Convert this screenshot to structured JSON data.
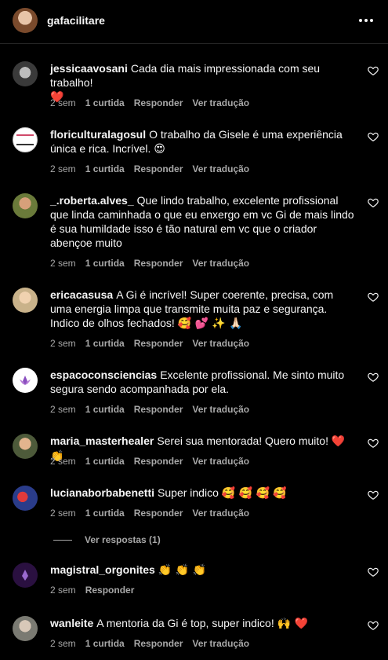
{
  "post": {
    "username": "gafacilitare"
  },
  "comments": [
    {
      "username": "jessicaavosani",
      "text": "Cada dia mais impressionada com seu trabalho!",
      "emoji": "❤️",
      "time": "2 sem",
      "likes": "1 curtida",
      "reply": "Responder",
      "translate": "Ver tradução"
    },
    {
      "username": "floriculturalagosul",
      "text": "O trabalho da Gisele é uma experiência única e rica. Incrível.",
      "emoji": "😍",
      "time": "2 sem",
      "likes": "1 curtida",
      "reply": "Responder",
      "translate": "Ver tradução"
    },
    {
      "username": "_.roberta.alves_",
      "text": "Que lindo trabalho, excelente profissional que linda caminhada o que eu enxergo em vc Gi de mais lindo é sua humildade isso é tão natural em vc que o criador abençoe muito",
      "emoji": "",
      "time": "2 sem",
      "likes": "1 curtida",
      "reply": "Responder",
      "translate": "Ver tradução"
    },
    {
      "username": "ericacasusa",
      "text": "A Gi é incrível! Super coerente, precisa, com uma energia limpa que transmite muita paz e segurança. Indico de olhos fechados!",
      "emoji": "🥰 💕 ✨ 🙏🏻",
      "time": "2 sem",
      "likes": "1 curtida",
      "reply": "Responder",
      "translate": "Ver tradução"
    },
    {
      "username": "espacoconsciencias",
      "text": "Excelente profissional. Me sinto muito segura sendo acompanhada por ela.",
      "emoji": "",
      "time": "2 sem",
      "likes": "1 curtida",
      "reply": "Responder",
      "translate": "Ver tradução"
    },
    {
      "username": "maria_masterhealer",
      "text": "Serei sua mentorada! Quero muito!",
      "emoji": "❤️ 👏",
      "time": "2 sem",
      "likes": "1 curtida",
      "reply": "Responder",
      "translate": "Ver tradução"
    },
    {
      "username": "lucianaborbabenetti",
      "text": "Super indico",
      "emoji": "🥰 🥰 🥰 🥰",
      "time": "2 sem",
      "likes": "1 curtida",
      "reply": "Responder",
      "translate": "Ver tradução",
      "view_replies": "Ver respostas (1)"
    },
    {
      "username": "magistral_orgonites",
      "text": "",
      "emoji": "👏 👏 👏",
      "time": "2 sem",
      "likes": "",
      "reply": "Responder",
      "translate": ""
    },
    {
      "username": "wanleite",
      "text": "A mentoria da Gi é top, super indico!",
      "emoji": "🙌 ❤️",
      "time": "2 sem",
      "likes": "1 curtida",
      "reply": "Responder",
      "translate": "Ver tradução"
    }
  ],
  "icons": {
    "more": "more-horizontal-icon",
    "like": "heart-outline-icon"
  },
  "colors": {
    "background": "#000000",
    "text": "#f5f5f5",
    "muted": "#a8a8a8",
    "heart": "#ff3040"
  }
}
